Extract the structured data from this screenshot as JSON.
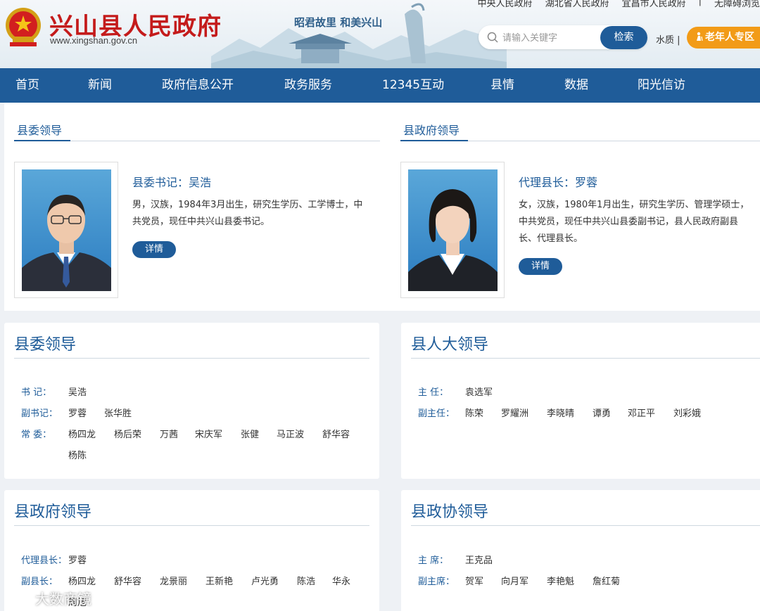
{
  "header": {
    "site_title": "兴山县人民政府",
    "site_url": "www.xingshan.gov.cn",
    "slogan": "昭君故里  和美兴山",
    "top_links": [
      "中央人民政府",
      "湖北省人民政府",
      "宜昌市人民政府",
      "|",
      "无障碍浏览"
    ],
    "search_placeholder": "请输入关键字",
    "search_button": "检索",
    "water_link": "水质 |",
    "elder_button": "老年人专区"
  },
  "nav": {
    "items": [
      "首页",
      "新闻",
      "政府信息公开",
      "政务服务",
      "12345互动",
      "县情",
      "数据",
      "阳光信访"
    ]
  },
  "featured": {
    "left": {
      "tab": "县委领导",
      "name": "县委书记：吴浩",
      "bio": "男，汉族，1984年3月出生，研究生学历、工学博士，中共党员，现任中共兴山县委书记。",
      "detail": "详情"
    },
    "right": {
      "tab": "县政府领导",
      "name": "代理县长：罗蓉",
      "bio": "女，汉族，1980年1月出生，研究生学历、管理学硕士，中共党员，现任中共兴山县委副书记，县人民政府副县长、代理县长。",
      "detail": "详情"
    }
  },
  "cards": {
    "county_committee": {
      "title": "县委领导",
      "rows": [
        {
          "label": "书    记：",
          "names": [
            "吴浩"
          ]
        },
        {
          "label": "副书记：",
          "names": [
            "罗蓉",
            "张华胜"
          ]
        },
        {
          "label": "常    委：",
          "names": [
            "杨四龙",
            "杨后荣",
            "万茜",
            "宋庆军",
            "张健",
            "马正波",
            "舒华容"
          ]
        },
        {
          "label": "",
          "names": [
            "杨陈"
          ]
        }
      ]
    },
    "peoples_congress": {
      "title": "县人大领导",
      "rows": [
        {
          "label": "主    任：",
          "names": [
            "袁选军"
          ]
        },
        {
          "label": "副主任：",
          "names": [
            "陈荣",
            "罗耀洲",
            "李晓晴",
            "谭勇",
            "邓正平",
            "刘彩娥"
          ]
        }
      ]
    },
    "government": {
      "title": "县政府领导",
      "rows": [
        {
          "label": "代理县长：",
          "names": [
            "罗蓉"
          ]
        },
        {
          "label": "副县长：",
          "names": [
            "杨四龙",
            "舒华容",
            "龙景丽",
            "王新艳",
            "卢光勇",
            "陈浩",
            "华永"
          ]
        },
        {
          "label": "",
          "names": [
            "周旭"
          ]
        }
      ]
    },
    "cppcc": {
      "title": "县政协领导",
      "rows": [
        {
          "label": "主    席：",
          "names": [
            "王克品"
          ]
        },
        {
          "label": "副主席：",
          "names": [
            "贺军",
            "向月军",
            "李艳魁",
            "詹红菊"
          ]
        }
      ]
    }
  },
  "watermark": "大数商镜"
}
